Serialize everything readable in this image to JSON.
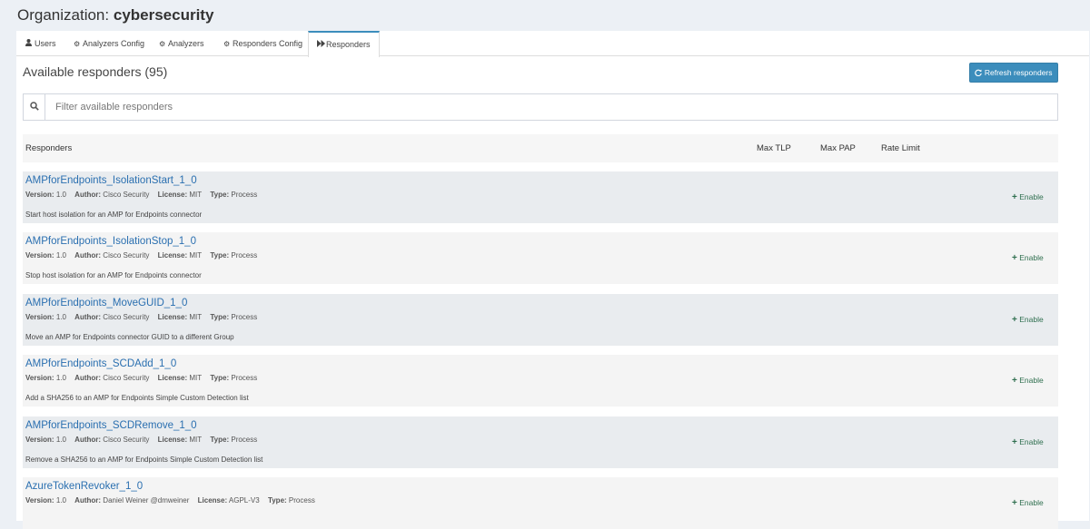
{
  "header": {
    "org_label": "Organization:",
    "org_name": "cybersecurity"
  },
  "tabs": [
    {
      "label": "Users",
      "icon": "user-icon"
    },
    {
      "label": "Analyzers Config",
      "icon": "cog-icon"
    },
    {
      "label": "Analyzers",
      "icon": "cogs-icon"
    },
    {
      "label": "Responders Config",
      "icon": "cog-icon"
    },
    {
      "label": "Responders",
      "icon": "forward-icon",
      "active": true
    }
  ],
  "section": {
    "title": "Available responders (95)",
    "refresh_label": "Refresh responders"
  },
  "filter": {
    "placeholder": "Filter available responders",
    "value": ""
  },
  "table": {
    "headers": {
      "responders": "Responders",
      "max_tlp": "Max TLP",
      "max_pap": "Max PAP",
      "rate_limit": "Rate Limit"
    },
    "meta_labels": {
      "version": "Version:",
      "author": "Author:",
      "license": "License:",
      "type": "Type:"
    },
    "enable_label": "Enable",
    "rows": [
      {
        "name": "AMPforEndpoints_IsolationStart_1_0",
        "version": "1.0",
        "author": "Cisco Security",
        "license": "MIT",
        "type": "Process",
        "description": "Start host isolation for an AMP for Endpoints connector"
      },
      {
        "name": "AMPforEndpoints_IsolationStop_1_0",
        "version": "1.0",
        "author": "Cisco Security",
        "license": "MIT",
        "type": "Process",
        "description": "Stop host isolation for an AMP for Endpoints connector"
      },
      {
        "name": "AMPforEndpoints_MoveGUID_1_0",
        "version": "1.0",
        "author": "Cisco Security",
        "license": "MIT",
        "type": "Process",
        "description": "Move an AMP for Endpoints connector GUID to a different Group"
      },
      {
        "name": "AMPforEndpoints_SCDAdd_1_0",
        "version": "1.0",
        "author": "Cisco Security",
        "license": "MIT",
        "type": "Process",
        "description": "Add a SHA256 to an AMP for Endpoints Simple Custom Detection list"
      },
      {
        "name": "AMPforEndpoints_SCDRemove_1_0",
        "version": "1.0",
        "author": "Cisco Security",
        "license": "MIT",
        "type": "Process",
        "description": "Remove a SHA256 to an AMP for Endpoints Simple Custom Detection list"
      },
      {
        "name": "AzureTokenRevoker_1_0",
        "version": "1.0",
        "author": "Daniel Weiner @dmweiner",
        "license": "AGPL-V3",
        "type": "Process",
        "description": ""
      }
    ]
  },
  "colors": {
    "primary": "#3c8dbc",
    "link": "#2a6fb0",
    "enable": "#2f6f4f",
    "background": "#ecf0f5"
  }
}
